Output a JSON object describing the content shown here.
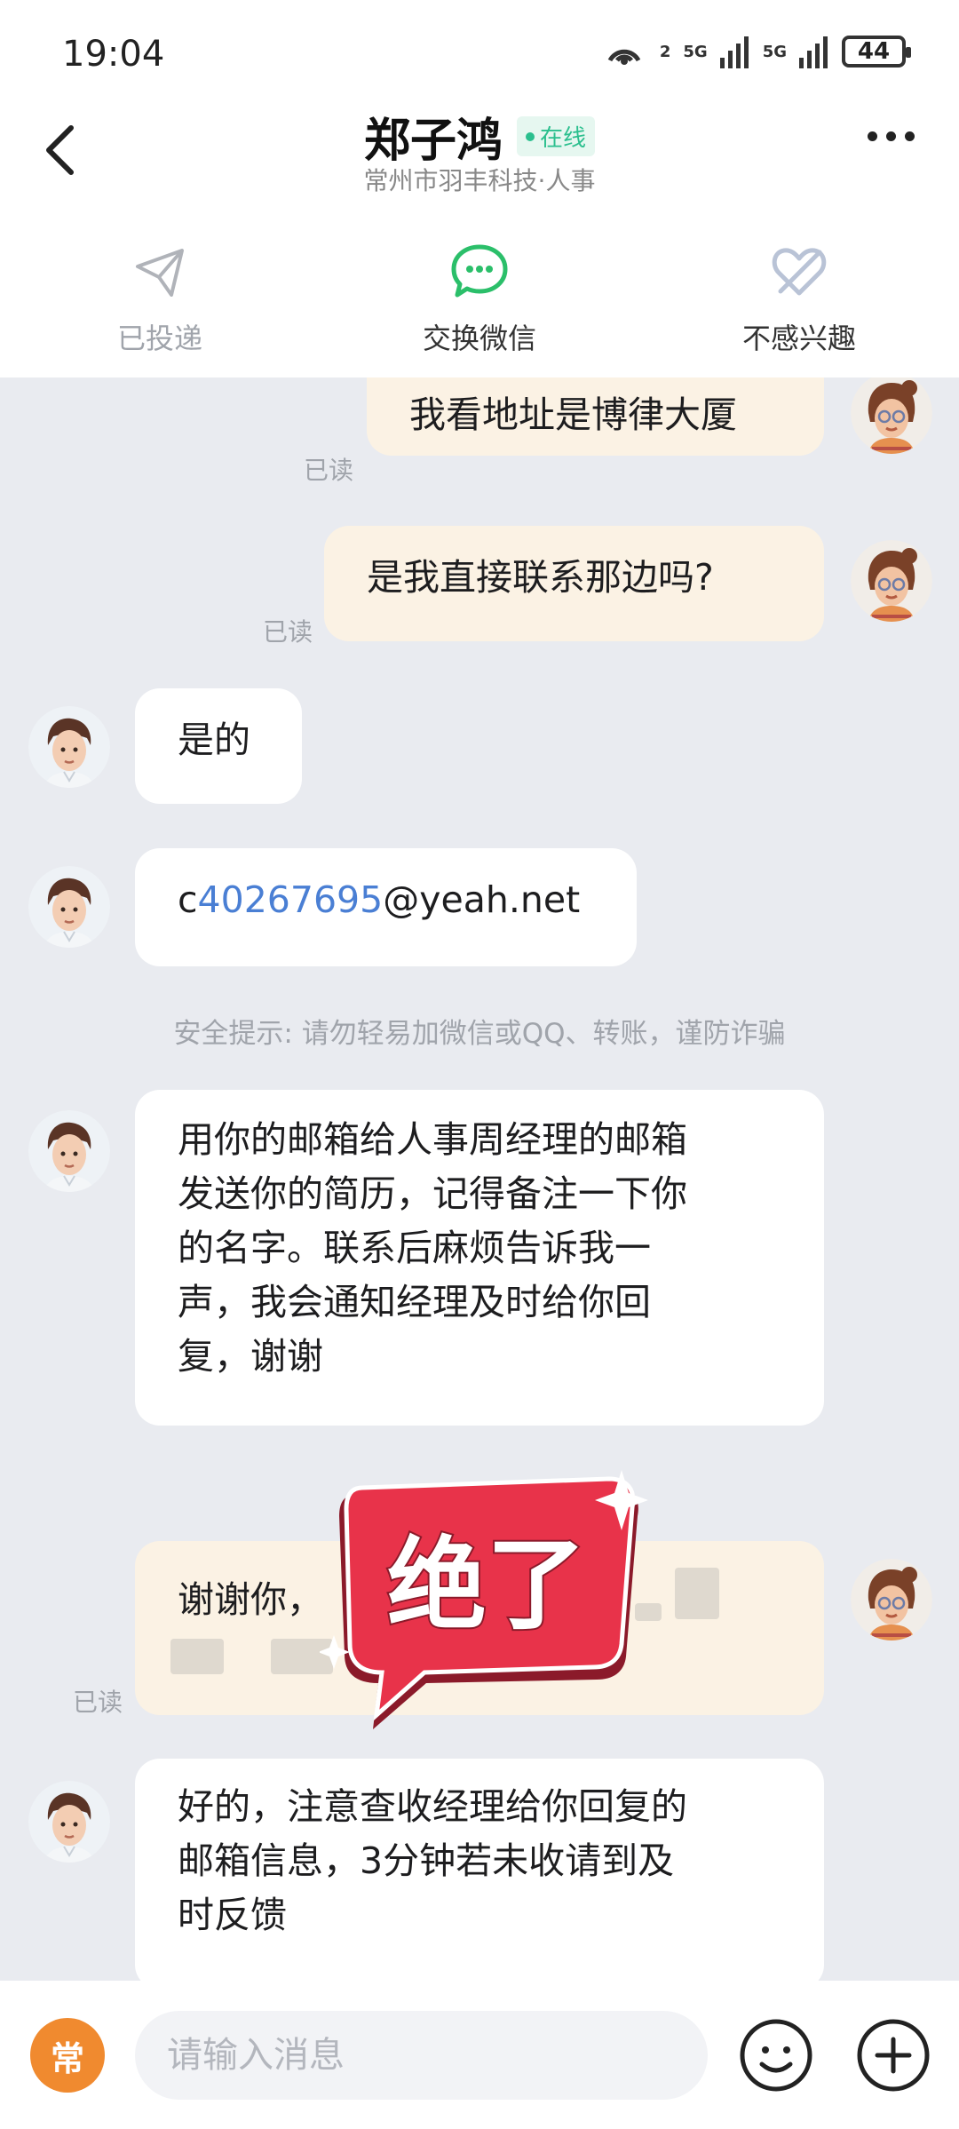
{
  "status_bar": {
    "time": "19:04",
    "battery": "44",
    "net1": "5G",
    "net2": "5G",
    "hotspot_count": "2"
  },
  "header": {
    "contact_name": "郑子鸿",
    "online_status": "在线",
    "subtitle": "常州市羽丰科技·人事"
  },
  "actions": [
    {
      "label": "已投递",
      "icon": "paper-plane-icon",
      "color": "#b0b3b9"
    },
    {
      "label": "交换微信",
      "icon": "wechat-icon",
      "color": "#2bbf6a"
    },
    {
      "label": "不感兴趣",
      "icon": "no-interest-icon",
      "color": "#b9c3d6"
    }
  ],
  "messages": [
    {
      "side": "out",
      "text": "我看地址是博律大厦",
      "read": "已读"
    },
    {
      "side": "out",
      "text": "是我直接联系那边吗?",
      "read": "已读"
    },
    {
      "side": "in",
      "text": "是的"
    },
    {
      "side": "in",
      "text_prefix": "c",
      "text_link": "40267695",
      "text_suffix": "@yeah.net"
    },
    {
      "side": "in",
      "lines": [
        "用你的邮箱给人事周经理的邮箱",
        "发送你的简历，记得备注一下你",
        "的名字。联系后麻烦告诉我一",
        "声，我会通知经理及时给你回",
        "复，谢谢"
      ]
    },
    {
      "side": "out",
      "text": "谢谢你，",
      "read": "已读"
    },
    {
      "side": "in",
      "lines": [
        "好的，注意查收经理给你回复的",
        "邮箱信息，3分钟若未收请到及",
        "时反馈"
      ]
    }
  ],
  "safety_tip": "安全提示: 请勿轻易加微信或QQ、转账，谨防诈骗",
  "sticker_text": "绝了",
  "input": {
    "quick_label": "常",
    "placeholder": "请输入消息"
  },
  "colors": {
    "accent_orange": "#f08a2f",
    "online_green": "#2bbf8e",
    "link_blue": "#4a7fd4",
    "sticker_red": "#e8334a"
  }
}
